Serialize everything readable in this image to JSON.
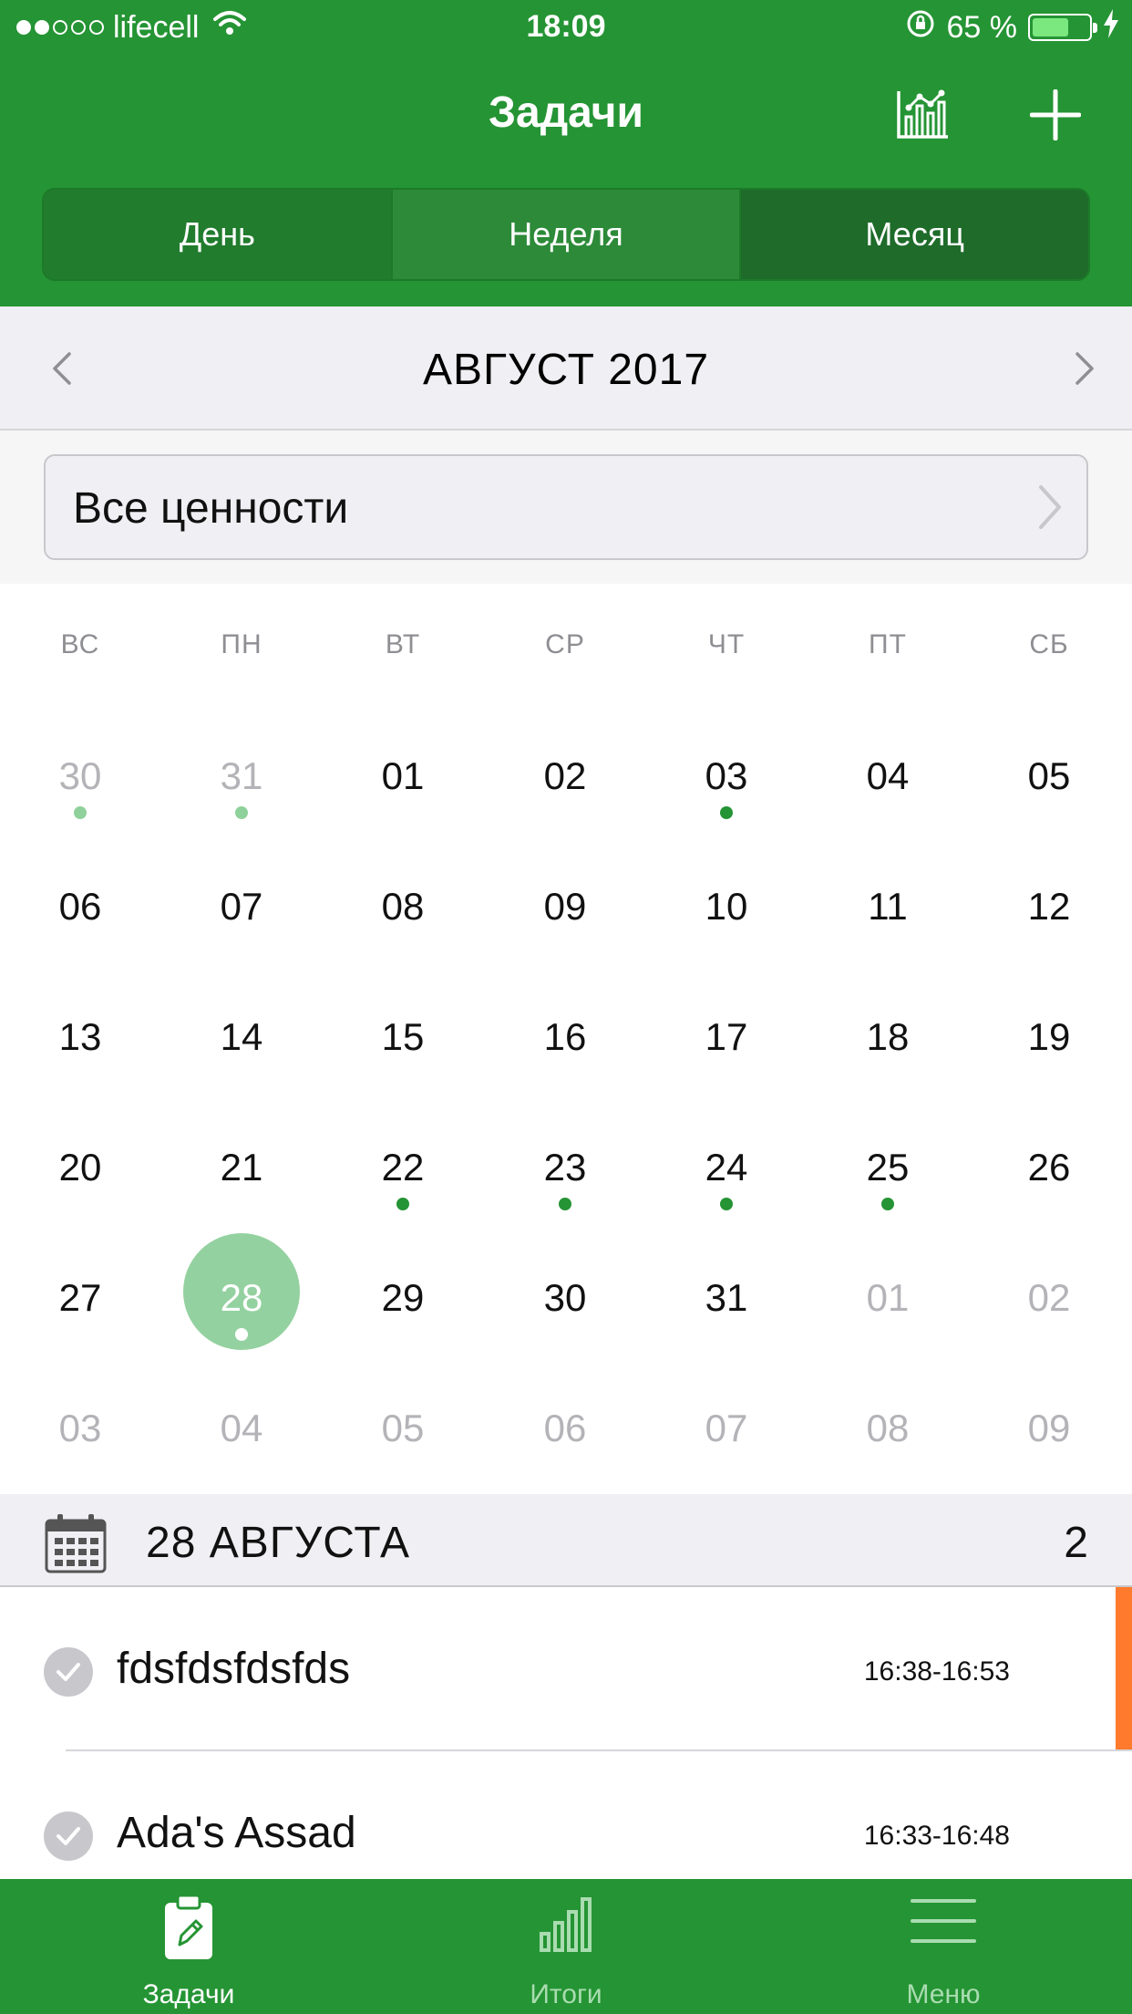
{
  "status_bar": {
    "carrier": "lifecell",
    "time": "18:09",
    "battery": "65 %",
    "battery_level": 0.65
  },
  "header": {
    "title": "Задачи",
    "stats_icon": "stats-chart-icon",
    "add_icon": "plus-icon"
  },
  "segments": [
    {
      "label": "День",
      "selected": false
    },
    {
      "label": "Неделя",
      "selected": false
    },
    {
      "label": "Месяц",
      "selected": true
    }
  ],
  "month_nav": {
    "title": "АВГУСТ 2017",
    "prev_icon": "chevron-left-icon",
    "next_icon": "chevron-right-icon"
  },
  "filter": {
    "label": "Все ценности",
    "chevron_icon": "chevron-right-icon"
  },
  "calendar": {
    "weekdays": [
      "ВС",
      "ПН",
      "ВТ",
      "СР",
      "ЧТ",
      "ПТ",
      "СБ"
    ],
    "weeks": [
      [
        {
          "d": "30",
          "m": true,
          "dot": true
        },
        {
          "d": "31",
          "m": true,
          "dot": true
        },
        {
          "d": "01"
        },
        {
          "d": "02"
        },
        {
          "d": "03",
          "dot": true
        },
        {
          "d": "04"
        },
        {
          "d": "05"
        }
      ],
      [
        {
          "d": "06"
        },
        {
          "d": "07"
        },
        {
          "d": "08"
        },
        {
          "d": "09"
        },
        {
          "d": "10"
        },
        {
          "d": "11"
        },
        {
          "d": "12"
        }
      ],
      [
        {
          "d": "13"
        },
        {
          "d": "14"
        },
        {
          "d": "15"
        },
        {
          "d": "16"
        },
        {
          "d": "17"
        },
        {
          "d": "18"
        },
        {
          "d": "19"
        }
      ],
      [
        {
          "d": "20"
        },
        {
          "d": "21"
        },
        {
          "d": "22",
          "dot": true
        },
        {
          "d": "23",
          "dot": true
        },
        {
          "d": "24",
          "dot": true
        },
        {
          "d": "25",
          "dot": true
        },
        {
          "d": "26"
        }
      ],
      [
        {
          "d": "27"
        },
        {
          "d": "28",
          "dot": true,
          "selected": true
        },
        {
          "d": "29"
        },
        {
          "d": "30"
        },
        {
          "d": "31"
        },
        {
          "d": "01",
          "m": true
        },
        {
          "d": "02",
          "m": true
        }
      ],
      [
        {
          "d": "03",
          "m": true
        },
        {
          "d": "04",
          "m": true
        },
        {
          "d": "05",
          "m": true
        },
        {
          "d": "06",
          "m": true
        },
        {
          "d": "07",
          "m": true
        },
        {
          "d": "08",
          "m": true
        },
        {
          "d": "09",
          "m": true
        }
      ]
    ]
  },
  "day_section": {
    "date": "28 АВГУСТА",
    "count": "2",
    "icon": "calendar-icon"
  },
  "tasks": [
    {
      "name": "fdsfdsfdsfds",
      "time": "16:38-16:53",
      "priority_color": "#ff7a2d"
    },
    {
      "name": "Ada's Assad",
      "time": "16:33-16:48",
      "priority_color": ""
    }
  ],
  "tabbar": [
    {
      "label": "Задачи",
      "icon": "clipboard-pencil-icon",
      "active": true
    },
    {
      "label": "Итоги",
      "icon": "bar-chart-icon",
      "active": false
    },
    {
      "label": "Меню",
      "icon": "hamburger-menu-icon",
      "active": false
    }
  ],
  "colors": {
    "brand_green": "#259434",
    "accent_light_green": "#94d1a0",
    "priority_orange": "#ff7a2d"
  }
}
